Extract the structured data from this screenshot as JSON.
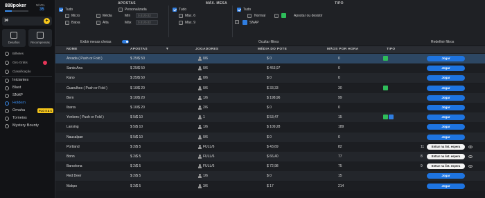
{
  "sidebar": {
    "logo": "888poker",
    "level_label": "NÍVEL",
    "level_value": "35",
    "level_progress": 0.3,
    "balance": "1¢",
    "tiles": [
      {
        "label": "Desafios",
        "icon": "trophy-icon"
      },
      {
        "label": "Recompensas",
        "icon": "gift-icon"
      }
    ],
    "small_items": [
      {
        "label": "Bilhetes",
        "icon": "ticket-icon"
      },
      {
        "label": "Giro Grátis",
        "icon": "wheel-icon"
      },
      {
        "label": "Classificação",
        "icon": "podium-icon"
      }
    ],
    "games": [
      {
        "label": "Iniciantes",
        "icon": "flag-icon"
      },
      {
        "label": "Blast",
        "icon": "blast-icon"
      },
      {
        "label": "SNAP",
        "icon": "snap-icon"
      },
      {
        "label": "Holdem",
        "icon": "cards-icon",
        "active": true
      },
      {
        "label": "Omaha",
        "icon": "omaha-icon",
        "badge": "PLO 5 & 6"
      },
      {
        "label": "Torneios",
        "icon": "tournament-icon"
      },
      {
        "label": "Mystery Bounty",
        "icon": "bounty-icon"
      }
    ]
  },
  "filters": {
    "apostas_header": "APOSTAS",
    "max_mesa_header": "MÁX. MESA",
    "tipo_header": "TIPO",
    "apostas": {
      "tudo": "Tudo",
      "micro": "Micro",
      "baixa": "Baixa",
      "media": "Média",
      "alta": "Alta",
      "personalizada": "Personalizada",
      "min_label": "Mín",
      "max_label": "Máx",
      "min_value": "0.01/0.02",
      "max_value": "0.01/0.02"
    },
    "max_mesa": {
      "tudo": "Tudo",
      "max6": "Máx. 6",
      "max9": "Máx. 9"
    },
    "tipo": {
      "tudo": "Tudo",
      "normal": "Normal",
      "snap": "SNAP",
      "apostar_ou_desistir": "Apostar ou desistir"
    },
    "exibir_mesas_cheias": "Exibir mesas cheias",
    "ocultar_filtros": "Ocultar filtros",
    "redefinir_filtros": "Redefinir filtros"
  },
  "table": {
    "headers": {
      "nome": "NOME",
      "apostas": "APOSTAS",
      "jogadores": "JOGADORES",
      "media_pote": "MÉDIA DO POTE",
      "maos_hora": "MÃOS POR HORA",
      "tipo": "TIPO"
    },
    "join_label": "Jogar",
    "wait_label": "Entrar na list. espera",
    "rows": [
      {
        "nome": "Arvada ( Push or Fold )",
        "apostas": "$ 25/$ 50",
        "jogadores": "0/6",
        "media": "$ 0",
        "maos": "0",
        "tipo": "green",
        "action": "join",
        "selected": true
      },
      {
        "nome": "Santa Ana",
        "apostas": "$ 25/$ 50",
        "jogadores": "0/6",
        "media": "$ 453,97",
        "maos": "0",
        "tipo": "",
        "action": "join"
      },
      {
        "nome": "Kano",
        "apostas": "$ 25/$ 50",
        "jogadores": "0/6",
        "media": "$ 0",
        "maos": "0",
        "tipo": "",
        "action": "join"
      },
      {
        "nome": "Guarulhos ( Push or Fold )",
        "apostas": "$ 10/$ 20",
        "jogadores": "0/6",
        "media": "$ 33,33",
        "maos": "30",
        "tipo": "green",
        "action": "join"
      },
      {
        "nome": "Bern",
        "apostas": "$ 10/$ 20",
        "jogadores": "1/6",
        "media": "$ 198,96",
        "maos": "99",
        "tipo": "",
        "action": "join"
      },
      {
        "nome": "Ibarra",
        "apostas": "$ 10/$ 20",
        "jogadores": "2/6",
        "media": "$ 0",
        "maos": "0",
        "tipo": "",
        "action": "join"
      },
      {
        "nome": "Yonkers ( Push or Fold )",
        "apostas": "$ 5/$ 10",
        "jogadores": "1",
        "media": "$ 53,47",
        "maos": "15",
        "tipo": "green-blue",
        "action": "join"
      },
      {
        "nome": "Lansing",
        "apostas": "$ 5/$ 10",
        "jogadores": "1/6",
        "media": "$ 109,28",
        "maos": "189",
        "tipo": "",
        "action": "join"
      },
      {
        "nome": "Naucalpan",
        "apostas": "$ 5/$ 10",
        "jogadores": "0/6",
        "media": "$ 0",
        "maos": "0",
        "tipo": "",
        "action": "join"
      },
      {
        "nome": "Portland",
        "apostas": "$ 2/$ 5",
        "jogadores": "FULL/6",
        "media": "$ 43,69",
        "maos": "82",
        "tipo": "",
        "action": "wait",
        "waitcount": "11"
      },
      {
        "nome": "Bonn",
        "apostas": "$ 2/$ 5",
        "jogadores": "FULL/6",
        "media": "$ 66,40",
        "maos": "77",
        "tipo": "",
        "action": "wait",
        "waitcount": "8"
      },
      {
        "nome": "Barcelona",
        "apostas": "$ 2/$ 5",
        "jogadores": "FULL/6",
        "media": "$ 72,98",
        "maos": "75",
        "tipo": "",
        "action": "wait",
        "waitcount": "9"
      },
      {
        "nome": "Red Deer",
        "apostas": "$ 2/$ 5",
        "jogadores": "1/6",
        "media": "$ 0",
        "maos": "15",
        "tipo": "",
        "action": "join"
      },
      {
        "nome": "Makpo",
        "apostas": "$ 2/$ 5",
        "jogadores": "3/6",
        "media": "$ 17",
        "maos": "214",
        "tipo": "",
        "action": "join"
      }
    ]
  },
  "colors": {
    "accent": "#1e74e0",
    "tag_green": "#2ebd5a",
    "selected_row": "#2d4763"
  }
}
